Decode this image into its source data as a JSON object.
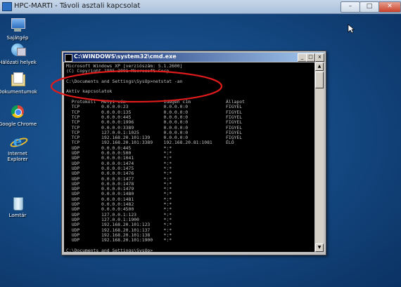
{
  "rdp_window": {
    "title": "HPC-MARTI - Távoli asztali kapcsolat",
    "minimize": "–",
    "maximize": "□",
    "close": "✕"
  },
  "desktop_icons": [
    {
      "label": "Sajátgép",
      "icon": "computer-icon"
    },
    {
      "label": "Hálózati helyek",
      "icon": "network-places-icon"
    },
    {
      "label": "Dokumentumok",
      "icon": "documents-icon"
    },
    {
      "label": "Google Chrome",
      "icon": "chrome-icon"
    },
    {
      "label": "Internet Explorer",
      "icon": "internet-explorer-icon"
    },
    {
      "label": "Lomtár",
      "icon": "recycle-bin-icon"
    }
  ],
  "cmd_window": {
    "title": "C:\\WINDOWS\\system32\\cmd.exe",
    "minimize": "_",
    "maximize": "□",
    "close": "x",
    "lines": [
      "Microsoft Windows XP [verziószám: 5.1.2600]",
      "(C) Copyright 1985-2001 Microsoft Corp.",
      "",
      "C:\\Documents and Settings\\SysOp>netstat -an",
      "",
      "Aktív kapcsolatok",
      "",
      "  Protokoll  Helyi cím              Idegen cím             Állapot",
      "  TCP        0.0.0.0:23             0.0.0.0:0              FIGYEL",
      "  TCP        0.0.0.0:135            0.0.0.0:0              FIGYEL",
      "  TCP        0.0.0.0:445            0.0.0.0:0              FIGYEL",
      "  TCP        0.0.0.0:1996           0.0.0.0:0              FIGYEL",
      "  TCP        0.0.0.0:3389           0.0.0.0:0              FIGYEL",
      "  TCP        127.0.0.1:1025         0.0.0.0:0              FIGYEL",
      "  TCP        192.168.20.101:139     0.0.0.0:0              FIGYEL",
      "  TCP        192.168.20.101:3389    192.168.20.81:1081     ÉLŐ",
      "  UDP        0.0.0.0:445            *:*",
      "  UDP        0.0.0.0:500            *:*",
      "  UDP        0.0.0.0:1041           *:*",
      "  UDP        0.0.0.0:1474           *:*",
      "  UDP        0.0.0.0:1475           *:*",
      "  UDP        0.0.0.0:1476           *:*",
      "  UDP        0.0.0.0:1477           *:*",
      "  UDP        0.0.0.0:1478           *:*",
      "  UDP        0.0.0.0:1479           *:*",
      "  UDP        0.0.0.0:1480           *:*",
      "  UDP        0.0.0.0:1481           *:*",
      "  UDP        0.0.0.0:1482           *:*",
      "  UDP        0.0.0.0:4500           *:*",
      "  UDP        127.0.0.1:123          *:*",
      "  UDP        127.0.0.1:1900         *:*",
      "  UDP        192.168.20.101:123     *:*",
      "  UDP        192.168.20.101:137     *:*",
      "  UDP        192.168.20.101:138     *:*",
      "  UDP        192.168.20.101:1900    *:*",
      "",
      "C:\\Documents and Settings\\SysOp>_"
    ]
  },
  "colors": {
    "annotation": "#e01b1b",
    "console_text": "#c0c0c0",
    "console_bg": "#000000"
  }
}
